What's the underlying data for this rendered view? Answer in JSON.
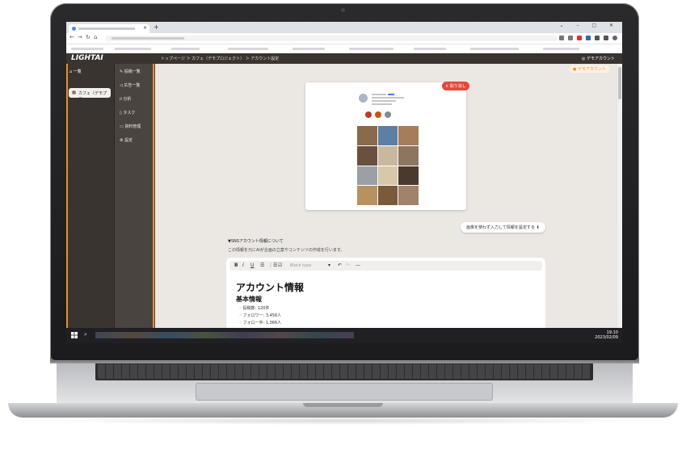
{
  "app": {
    "logo": "LIGHTAI",
    "breadcrumb": "トップページ ＞ カフェ（デモプロジェクト） ＞ アカウント設定",
    "account_label": "◎ デモアカウント",
    "demo_badge": "● デモアカウント"
  },
  "sidebar_primary": {
    "items": [
      {
        "label": "⌂ 一覧"
      }
    ],
    "selected_project": "カフェ（デモプロ..."
  },
  "sidebar_secondary": {
    "items": [
      {
        "label": "✎ 投稿一覧"
      },
      {
        "label": "◁ 広告一覧"
      },
      {
        "label": "ıl 分析"
      },
      {
        "label": "▯ タスク"
      },
      {
        "label": "▭ 資料管理"
      },
      {
        "label": "⚙ 設定"
      }
    ]
  },
  "preview": {
    "clear_button": "× 取り消し"
  },
  "skip_button": "画像を使わず入力して情報を設定する ⬇",
  "section": {
    "title": "▼SNSアカウント情報について",
    "description": "この情報を元にAIが企画の立案やコンテンツの作成を行います。"
  },
  "editor": {
    "toolbar": {
      "bold": "B",
      "italic": "I",
      "underline": "U",
      "bullet_list": "☰",
      "numbered_list": "⋮☰",
      "check_list": "☑",
      "block_type_placeholder": "Block type",
      "dropdown": "▾",
      "undo": "↶",
      "redo": "↷",
      "hr": "—"
    },
    "heading1": "アカウント情報",
    "heading2": "基本情報",
    "list": [
      "投稿数: 120件",
      "フォロワー: 3,456人",
      "フォロー中: 1,366人"
    ]
  },
  "taskbar": {
    "search_icon": "⌕",
    "time": "19:10",
    "date": "2023/02/09"
  },
  "colors": {
    "accent": "#f08c2b",
    "danger": "#e8453c",
    "sidebar_dark": "#3a3430"
  }
}
